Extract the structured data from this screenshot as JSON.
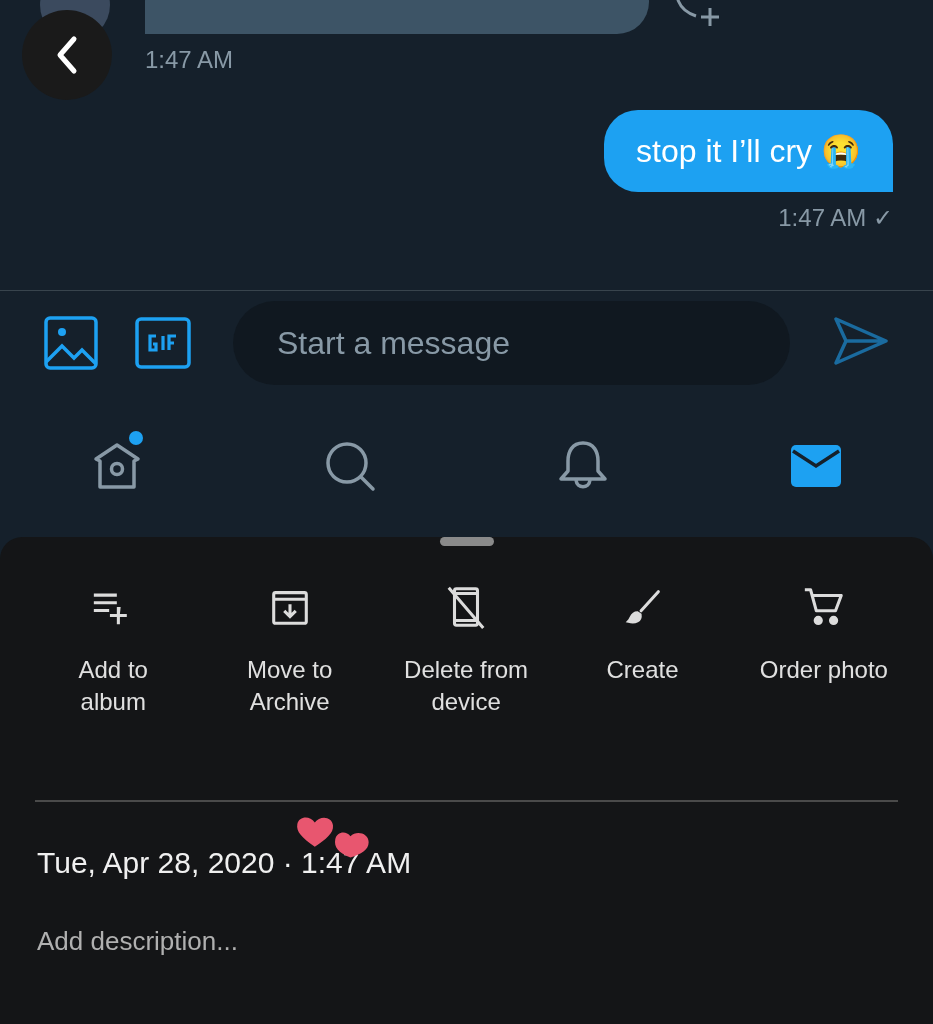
{
  "chat": {
    "messages": [
      {
        "kind": "incoming",
        "time": "1:47 AM"
      },
      {
        "kind": "outgoing",
        "text": "stop it I’ll cry 😭",
        "time": "1:47 AM ✓"
      }
    ]
  },
  "composer": {
    "placeholder": "Start a message"
  },
  "nav": [
    {
      "selected": false,
      "badge": true
    },
    {
      "selected": false,
      "badge": false
    },
    {
      "selected": false,
      "badge": false
    },
    {
      "selected": true,
      "badge": false
    }
  ],
  "sheet": {
    "actions": [
      {
        "label": "Add to album"
      },
      {
        "label": "Move to Archive"
      },
      {
        "label": "Delete from device"
      },
      {
        "label": "Create"
      },
      {
        "label": "Order photo"
      }
    ],
    "date": "Tue, Apr 28, 2020 · 1:47 AM",
    "description_placeholder": "Add description..."
  }
}
